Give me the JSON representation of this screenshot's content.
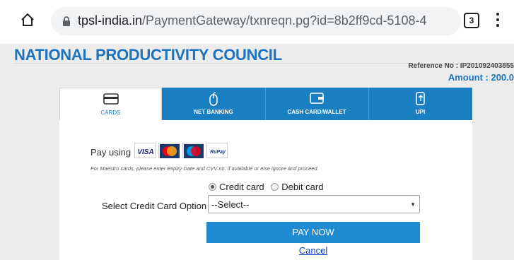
{
  "browser": {
    "url_host": "tpsl-india.in",
    "url_path": "/PaymentGateway/txnreqn.pg?id=8b2ff9cd-5108-4",
    "tab_count": "3"
  },
  "page": {
    "org_title": "NATIONAL PRODUCTIVITY COUNCIL",
    "reference": "Reference No : IP201092403855",
    "amount": "Amount : 200.0"
  },
  "tabs": [
    {
      "label": "CARDS"
    },
    {
      "label": "NET BANKING"
    },
    {
      "label": "CASH CARD/WALLET"
    },
    {
      "label": "UPI"
    }
  ],
  "form": {
    "pay_using": "Pay using",
    "logos": [
      "VISA",
      "MasterCard",
      "Maestro",
      "RuPay"
    ],
    "note": "For Maestro cards, please enter Expiry Date and CVV no. if available or else ignore and proceed.",
    "radio_credit": "Credit card",
    "radio_debit": "Debit card",
    "select_label": "Select Credit Card Option :",
    "select_value": "--Select--",
    "pay_button": "PAY NOW",
    "cancel_link": "Cancel"
  },
  "colors": {
    "brand_blue": "#1e73be",
    "tab_blue": "#1a7fc1",
    "button_blue": "#1f8bd0",
    "link_blue": "#0a3dc4"
  }
}
